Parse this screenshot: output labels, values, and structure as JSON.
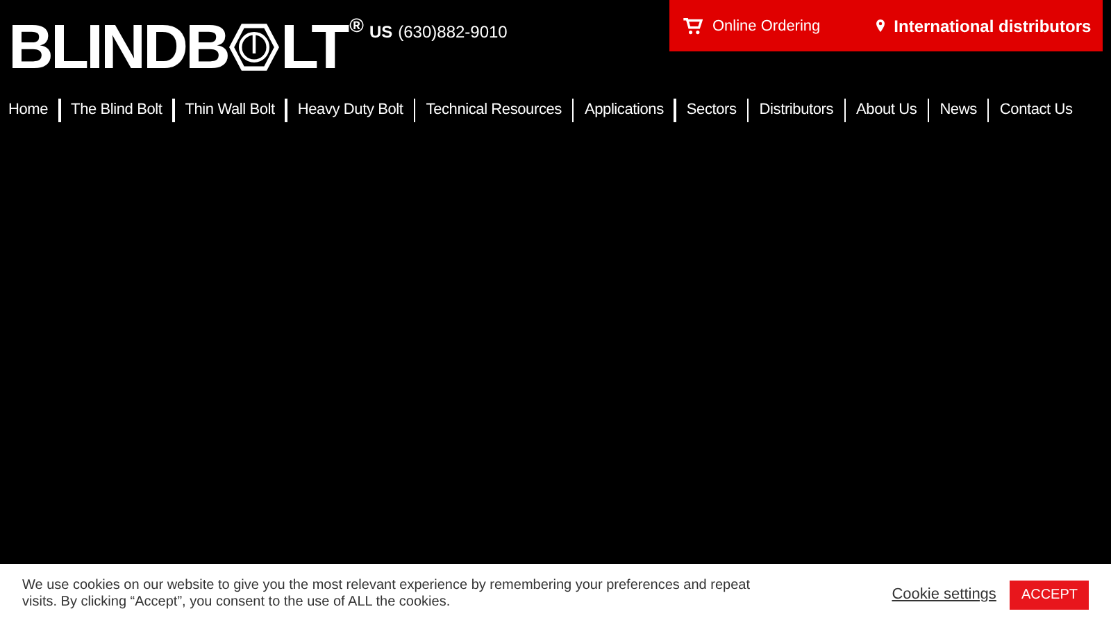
{
  "logo": {
    "before_mark": "BLINDB",
    "after_mark": "LT",
    "registered": "®"
  },
  "phone": {
    "country": "US",
    "number": "(630)882-9010"
  },
  "top_links": [
    {
      "kind": "cart",
      "label": "Online Ordering"
    },
    {
      "kind": "pin",
      "label": "International distributors"
    }
  ],
  "nav": [
    "Home",
    "The Blind Bolt",
    "Thin Wall Bolt",
    "Heavy Duty Bolt",
    "Technical Resources",
    "Applications",
    "Sectors",
    "Distributors",
    "About Us",
    "News",
    "Contact Us"
  ],
  "cookie_bar": {
    "message": "We use cookies on our website to give you the most relevant experience by remembering your preferences and repeat visits. By clicking “Accept”, you consent to the use of ALL the cookies.",
    "settings": "Cookie settings",
    "accept": "ACCEPT"
  }
}
